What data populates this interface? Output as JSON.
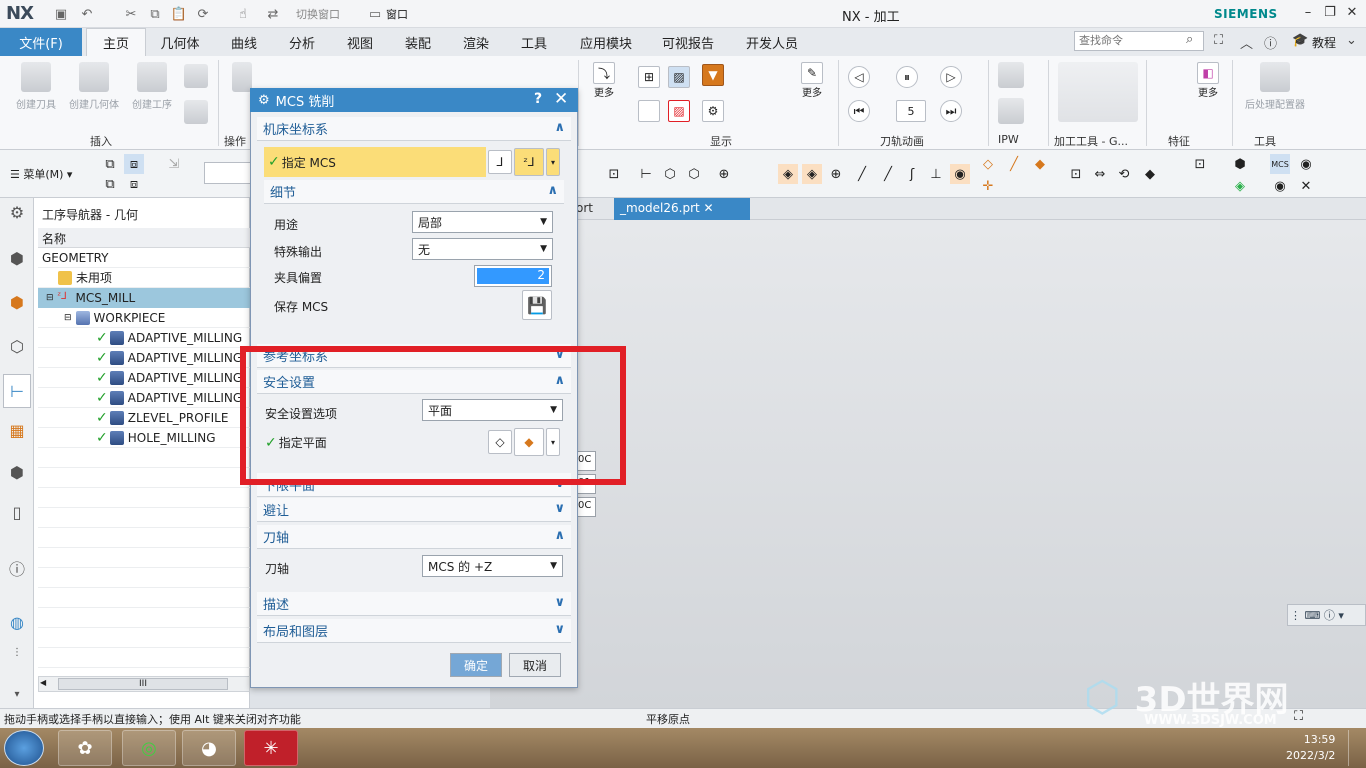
{
  "app": {
    "logo": "NX",
    "window_title": "NX - 加工",
    "brand": "SIEMENS",
    "tutorial": "教程"
  },
  "quickaccess": {
    "switch_window": "切换窗口",
    "window": "窗口"
  },
  "tabs": {
    "file": "文件(F)",
    "items": [
      "主页",
      "几何体",
      "曲线",
      "分析",
      "视图",
      "装配",
      "渲染",
      "工具",
      "应用模块",
      "可视报告",
      "开发人员"
    ]
  },
  "search": {
    "placeholder": "查找命令"
  },
  "ribbon": {
    "create_tool": "创建刀具",
    "create_geometry": "创建几何体",
    "create_operation": "创建工序",
    "group_insert": "插入",
    "group_operation": "操作",
    "group_display": "显示",
    "group_toolpath_anim": "刀轨动画",
    "group_ipw": "IPW",
    "group_machining_tools": "加工工具 - G...",
    "group_feature": "特征",
    "group_tools": "工具",
    "more": "更多",
    "postprocessor": "后处理配置器",
    "anim_speed": "5"
  },
  "toolbar2": {
    "menu": "菜单(M)"
  },
  "navigator": {
    "title": "工序导航器 - 几何",
    "column_name": "名称",
    "rows": [
      "GEOMETRY",
      "未用项",
      "MCS_MILL",
      "WORKPIECE",
      "ADAPTIVE_MILLING",
      "ADAPTIVE_MILLING",
      "ADAPTIVE_MILLING",
      "ADAPTIVE_MILLING",
      "ZLEVEL_PROFILE",
      "HOLE_MILLING"
    ],
    "scroll_thumb": "III"
  },
  "doc_tabs": {
    "previous": "ort",
    "active": "_model26.prt"
  },
  "side_values": [
    "0C",
    "01",
    "0C"
  ],
  "dialog": {
    "title": "MCS 铣削",
    "section_machine_csys": "机床坐标系",
    "specify_mcs": "指定 MCS",
    "section_details": "细节",
    "purpose_label": "用途",
    "purpose_value": "局部",
    "special_output_label": "特殊输出",
    "special_output_value": "无",
    "fixture_offset_label": "夹具偏置",
    "fixture_offset_value": "2",
    "save_mcs": "保存 MCS",
    "section_reference_csys": "参考坐标系",
    "section_clearance": "安全设置",
    "clearance_option_label": "安全设置选项",
    "clearance_option_value": "平面",
    "specify_plane": "指定平面",
    "section_lower_limit": "下限平面",
    "section_avoidance": "避让",
    "section_tool_axis": "刀轴",
    "tool_axis_label": "刀轴",
    "tool_axis_value": "MCS 的 +Z",
    "section_description": "描述",
    "section_layout": "布局和图层",
    "ok": "确定",
    "cancel": "取消"
  },
  "status": {
    "left": "拖动手柄或选择手柄以直接输入；使用 Alt 键来关闭对齐功能",
    "center": "平移原点"
  },
  "taskbar": {
    "time": "13:59",
    "date": "2022/3/2"
  },
  "watermark": {
    "brand": "3D世界网",
    "url": "WWW.3DSJW.COM"
  },
  "colors": {
    "accent": "#3a88c6",
    "highlight": "#fbdd78",
    "annotation": "#e11f26",
    "check": "#22a02a"
  }
}
